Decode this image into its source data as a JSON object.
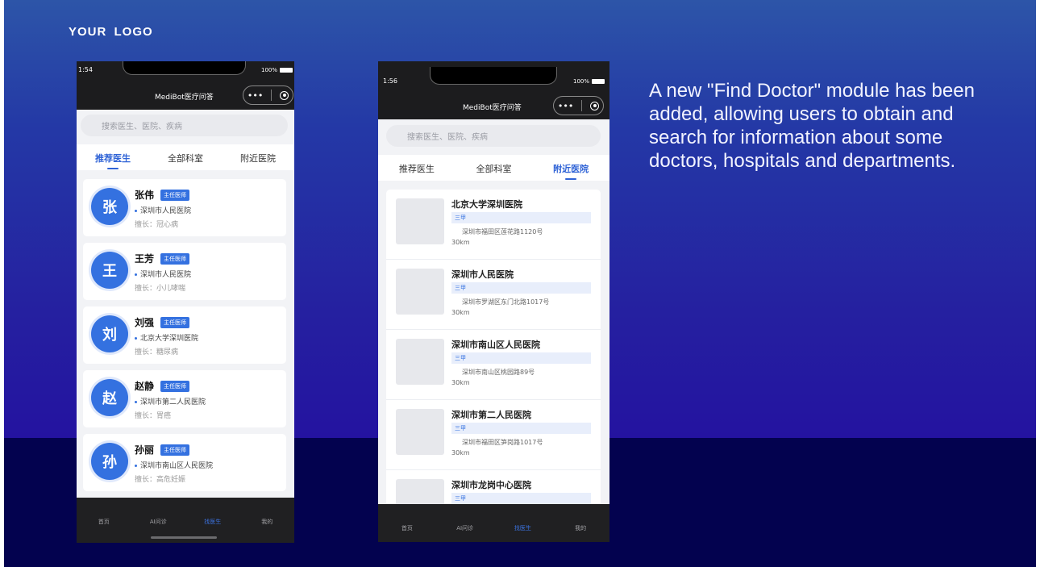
{
  "logo": "YOUR  LOGO",
  "description": "A new \"Find Doctor\" module has been added, allowing users to obtain and search for information about some doctors, hospitals and departments.",
  "colors": {
    "accent": "#3471e0",
    "background_top": "#2d55a8",
    "background_bottom": "#03024f"
  },
  "phone1": {
    "time": "1:54",
    "battery": "100%",
    "title": "MediBot医疗问答",
    "capsule_dots": "•••",
    "search_placeholder": "搜索医生、医院、疾病",
    "tabs": [
      {
        "label": "推荐医生",
        "active": true
      },
      {
        "label": "全部科室",
        "active": false
      },
      {
        "label": "附近医院",
        "active": false
      }
    ],
    "doctors": [
      {
        "avatar": "张",
        "name": "张伟",
        "badge": "主任医师",
        "hospital": "深圳市人民医院",
        "specialty": "擅长：冠心病"
      },
      {
        "avatar": "王",
        "name": "王芳",
        "badge": "主任医师",
        "hospital": "深圳市人民医院",
        "specialty": "擅长：小儿哮喘"
      },
      {
        "avatar": "刘",
        "name": "刘强",
        "badge": "主任医师",
        "hospital": "北京大学深圳医院",
        "specialty": "擅长：糖尿病"
      },
      {
        "avatar": "赵",
        "name": "赵静",
        "badge": "主任医师",
        "hospital": "深圳市第二人民医院",
        "specialty": "擅长：胃癌"
      },
      {
        "avatar": "孙",
        "name": "孙丽",
        "badge": "主任医师",
        "hospital": "深圳市南山区人民医院",
        "specialty": "擅长：高危妊娠"
      }
    ],
    "tabbar": [
      {
        "label": "首页"
      },
      {
        "label": "AI问诊"
      },
      {
        "label": "找医生"
      },
      {
        "label": "我的"
      }
    ]
  },
  "phone2": {
    "time": "1:56",
    "battery": "100%",
    "title": "MediBot医疗问答",
    "capsule_dots": "•••",
    "search_placeholder": "搜索医生、医院、疾病",
    "tabs": [
      {
        "label": "推荐医生",
        "active": false
      },
      {
        "label": "全部科室",
        "active": false
      },
      {
        "label": "附近医院",
        "active": true
      }
    ],
    "hospitals": [
      {
        "name": "北京大学深圳医院",
        "level": "三甲",
        "address": "深圳市福田区莲花路1120号",
        "distance": "30km"
      },
      {
        "name": "深圳市人民医院",
        "level": "三甲",
        "address": "深圳市罗湖区东门北路1017号",
        "distance": "30km"
      },
      {
        "name": "深圳市南山区人民医院",
        "level": "三甲",
        "address": "深圳市南山区桃园路89号",
        "distance": "30km"
      },
      {
        "name": "深圳市第二人民医院",
        "level": "三甲",
        "address": "深圳市福田区笋岗路1017号",
        "distance": "30km"
      },
      {
        "name": "深圳市龙岗中心医院",
        "level": "三甲",
        "address": "",
        "distance": ""
      }
    ],
    "tabbar": [
      {
        "label": "首页"
      },
      {
        "label": "AI问诊"
      },
      {
        "label": "找医生"
      },
      {
        "label": "我的"
      }
    ]
  }
}
